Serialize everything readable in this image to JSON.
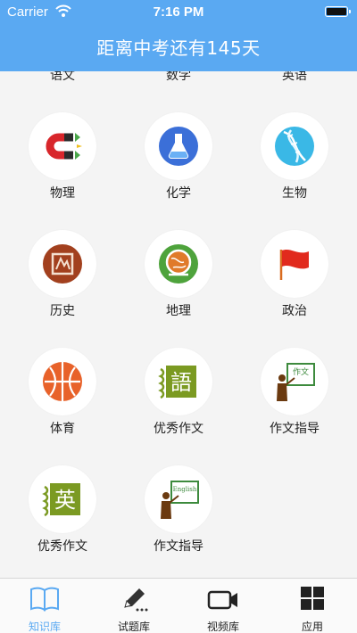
{
  "status_bar": {
    "carrier": "Carrier",
    "time": "7:16 PM"
  },
  "header": {
    "title": "距离中考还有145天"
  },
  "subjects": [
    {
      "label": "语文",
      "icon": "chinese-icon"
    },
    {
      "label": "数学",
      "icon": "math-icon"
    },
    {
      "label": "英语",
      "icon": "english-icon"
    },
    {
      "label": "物理",
      "icon": "magnet-icon"
    },
    {
      "label": "化学",
      "icon": "flask-icon"
    },
    {
      "label": "生物",
      "icon": "dna-icon"
    },
    {
      "label": "历史",
      "icon": "history-icon"
    },
    {
      "label": "地理",
      "icon": "globe-icon"
    },
    {
      "label": "政治",
      "icon": "flag-icon"
    },
    {
      "label": "体育",
      "icon": "basketball-icon"
    },
    {
      "label": "优秀作文",
      "icon": "chinese-essay-icon",
      "badge": "語"
    },
    {
      "label": "作文指导",
      "icon": "teacher-board-icon",
      "badge": "作文"
    },
    {
      "label": "优秀作文",
      "icon": "english-essay-icon",
      "badge": "英"
    },
    {
      "label": "作文指导",
      "icon": "teacher-board-english-icon",
      "badge": "English"
    }
  ],
  "tabs": [
    {
      "label": "知识库",
      "icon": "book-icon",
      "active": true
    },
    {
      "label": "试题库",
      "icon": "pencil-icon",
      "active": false
    },
    {
      "label": "视频库",
      "icon": "video-camera-icon",
      "active": false
    },
    {
      "label": "应用",
      "icon": "grid-icon",
      "active": false
    }
  ],
  "colors": {
    "header": "#5aa9f2",
    "active_tab": "#5aa9f2"
  }
}
